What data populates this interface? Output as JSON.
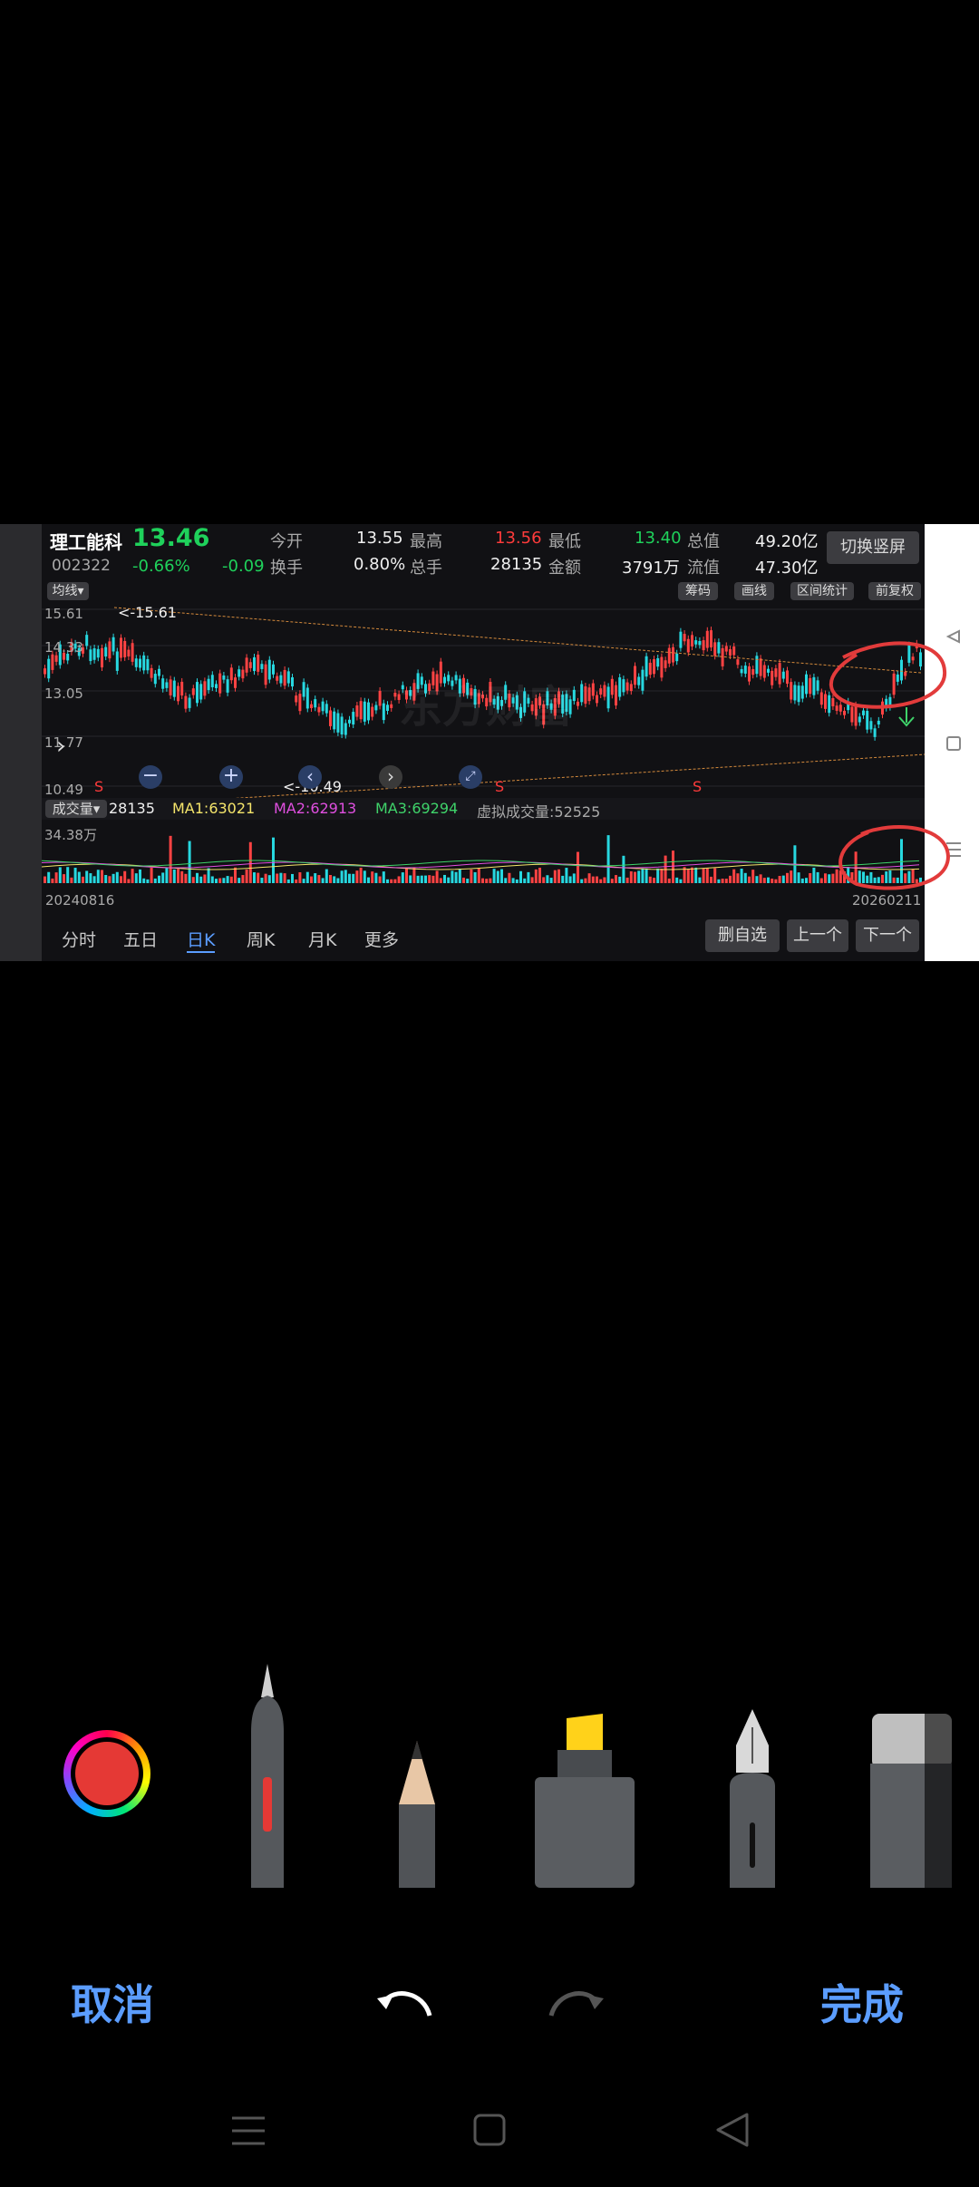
{
  "stock": {
    "name": "理工能科",
    "code": "002322",
    "price": "13.46",
    "change_pct": "-0.66%",
    "change": "-0.09",
    "open_label": "今开",
    "open": "13.55",
    "high_label": "最高",
    "high": "13.56",
    "low_label": "最低",
    "low": "13.40",
    "mcap_label": "总值",
    "mcap": "49.20亿",
    "turnover_label": "换手",
    "turnover": "0.80%",
    "volume_label": "总手",
    "volume": "28135",
    "amount_label": "金额",
    "amount": "3791万",
    "float_label": "流值",
    "float": "47.30亿",
    "switch_btn": "切换竖屏"
  },
  "toolbar": {
    "ma_label": "均线",
    "chips": "筹码",
    "draw": "画线",
    "range_stats": "区间统计",
    "adjust": "前复权"
  },
  "axis": {
    "y_labels": [
      "15.61",
      "14.33",
      "13.05",
      "11.77",
      "10.49"
    ],
    "max_marker": "<-15.61",
    "min_marker": "<-10.49",
    "watermark": "东方财富",
    "vol_max": "34.38万",
    "date_start": "20240816",
    "date_end": "20260211"
  },
  "volume_bar": {
    "selector": "成交量",
    "value": "28135",
    "ma1": "MA1:63021",
    "ma2": "MA2:62913",
    "ma3": "MA3:69294",
    "virtual": "虚拟成交量:52525"
  },
  "tabs": [
    "分时",
    "五日",
    "日K",
    "周K",
    "月K",
    "更多"
  ],
  "actions": {
    "remove": "删自选",
    "prev": "上一个",
    "next": "下一个"
  },
  "signals": [
    "S",
    "S",
    "S"
  ],
  "bottom": {
    "cancel": "取消",
    "done": "完成"
  },
  "colors": {
    "accent": "#5b9dff",
    "up": "#ff3b3b",
    "down": "#1fd15b",
    "pen": "#e53935"
  }
}
